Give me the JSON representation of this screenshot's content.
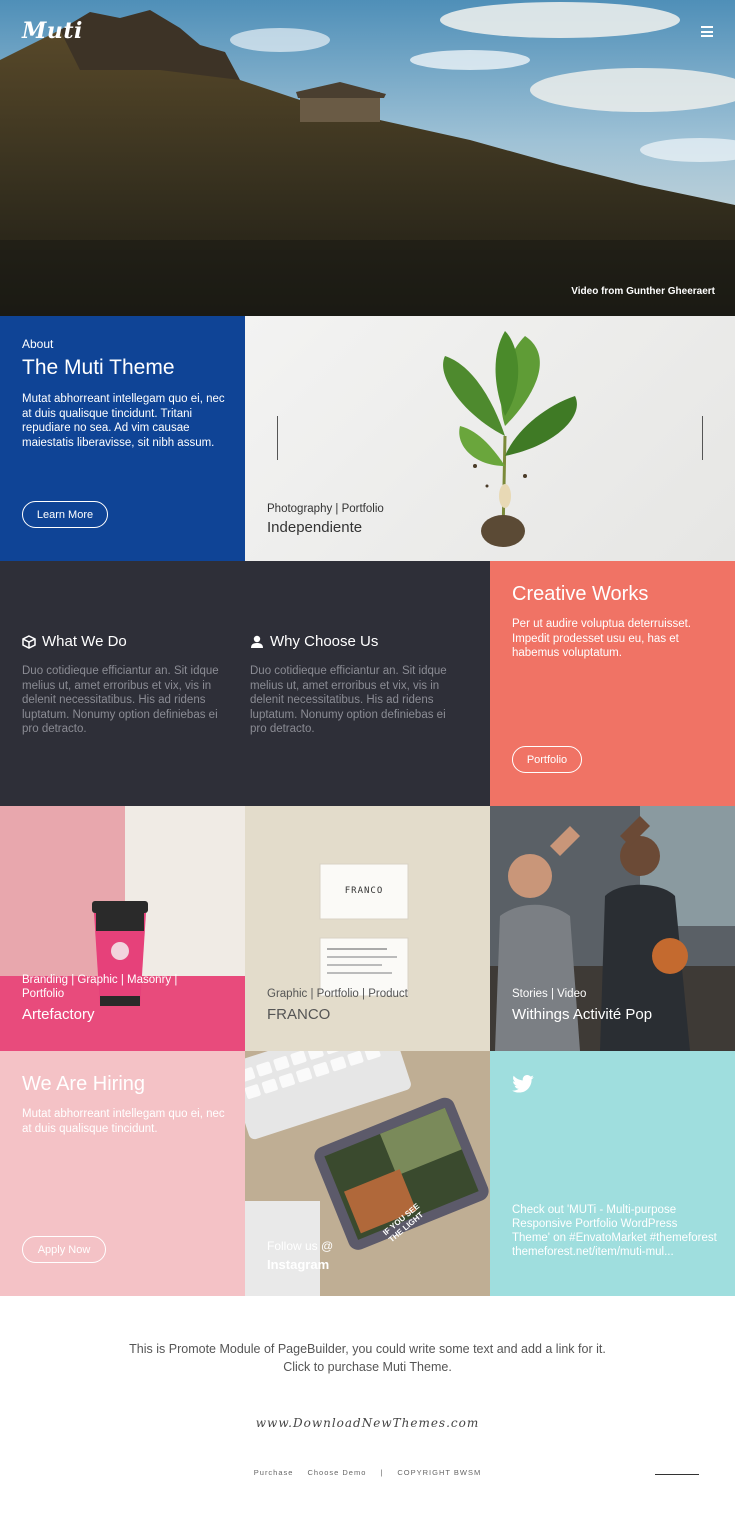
{
  "header": {
    "logo": "Muti",
    "menu_icon": "hamburger-icon"
  },
  "hero": {
    "caption": "Video from Gunther Gheeraert"
  },
  "about": {
    "kicker": "About",
    "title": "The Muti Theme",
    "description": "Mutat abhorreant intellegam quo ei, nec at duis qualisque tincidunt. Tritani repudiare no sea. Ad vim causae maiestatis liberavisse, sit nibh assum.",
    "button": "Learn More"
  },
  "featured": {
    "tags": "Photography | Portfolio",
    "title": "Independiente"
  },
  "services": [
    {
      "icon": "cube-icon",
      "title": "What We Do",
      "description": "Duo cotidieque efficiantur an. Sit idque melius ut, amet erroribus et vix, vis in delenit necessitatibus. His ad ridens luptatum. Nonumy option definiebas ei pro detracto."
    },
    {
      "icon": "user-icon",
      "title": "Why Choose Us",
      "description": "Duo cotidieque efficiantur an. Sit idque melius ut, amet erroribus et vix, vis in delenit necessitatibus. His ad ridens luptatum. Nonumy option definiebas ei pro detracto."
    }
  ],
  "creative": {
    "title": "Creative Works",
    "description": "Per ut audire voluptua deterruisset. Impedit prodesset usu eu, has et habemus voluptatum.",
    "button": "Portfolio"
  },
  "projects": [
    {
      "tags": "Branding | Graphic | Masonry | Portfolio",
      "title": "Artefactory"
    },
    {
      "tags": "Graphic | Portfolio | Product",
      "title": "FRANCO",
      "card_text": "FRANCO"
    },
    {
      "tags": "Stories | Video",
      "title": "Withings Activité Pop"
    }
  ],
  "hiring": {
    "title": "We Are Hiring",
    "description": "Mutat abhorreant intellegam quo ei, nec at duis qualisque tincidunt.",
    "button": "Apply Now"
  },
  "instagram": {
    "follow": "Follow us @",
    "handle": "Instagram",
    "tablet_text": "IF YOU SEE THE LIGHT"
  },
  "twitter": {
    "icon": "twitter-icon",
    "tweet": "Check out 'MUTi - Multi-purpose Responsive Portfolio WordPress Theme' on #EnvatoMarket #themeforest themeforest.net/item/muti-mul..."
  },
  "promo": {
    "line1": "This is Promote Module of PageBuilder, you could write some text and add a link for it.",
    "line2": "Click to purchase Muti Theme."
  },
  "watermark": "www.DownloadNewThemes.com",
  "footer": {
    "purchase": "Purchase",
    "choose_demo": "Choose Demo",
    "separator": "|",
    "copyright": "COPYRIGHT BWSM"
  },
  "colors": {
    "about_bg": "#0f4496",
    "services_bg": "#2e2f38",
    "creative_bg": "#f07365",
    "hiring_bg": "#f4c2c6",
    "twitter_bg": "#9fdede"
  }
}
